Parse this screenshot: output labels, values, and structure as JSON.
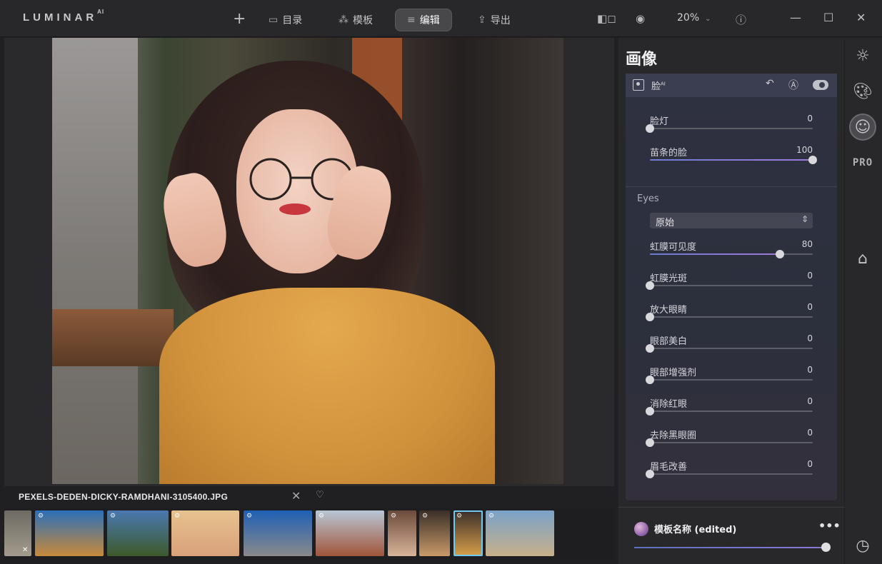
{
  "app": {
    "logo_text": "LUMINAR",
    "logo_sup": "AI"
  },
  "nav": {
    "add_label": "+",
    "catalog_label": "目录",
    "templates_label": "模板",
    "edit_label": "编辑",
    "export_label": "导出"
  },
  "toolbar": {
    "zoom_value": "20%"
  },
  "canvas": {
    "filename": "PEXELS-DEDEN-DICKY-RAMDHANI-3105400.JPG"
  },
  "filmstrip": {
    "thumbnails": [
      {
        "name": "thumb-partial",
        "selected": false,
        "colors": [
          "#6d6a62",
          "#a39c8e"
        ]
      },
      {
        "name": "thumb-mountain",
        "selected": false,
        "colors": [
          "#2b6fb8",
          "#c88a3a"
        ]
      },
      {
        "name": "thumb-landscape-clouds",
        "selected": false,
        "colors": [
          "#4a78b0",
          "#3e5a2a"
        ]
      },
      {
        "name": "thumb-girl-smile",
        "selected": false,
        "colors": [
          "#e6c38e",
          "#d9a07a"
        ]
      },
      {
        "name": "thumb-road-moon",
        "selected": false,
        "colors": [
          "#1f5fb4",
          "#8a8a8a"
        ]
      },
      {
        "name": "thumb-woman-curly",
        "selected": false,
        "colors": [
          "#b9c6d6",
          "#a0553a"
        ]
      },
      {
        "name": "thumb-portrait-warm",
        "selected": false,
        "colors": [
          "#6a4a3a",
          "#d8b49a"
        ]
      },
      {
        "name": "thumb-portrait-flower",
        "selected": false,
        "colors": [
          "#3a2e28",
          "#c89a6a"
        ]
      },
      {
        "name": "thumb-current",
        "selected": true,
        "colors": [
          "#3a2e2a",
          "#d8a04a"
        ]
      },
      {
        "name": "thumb-lake-mountains",
        "selected": false,
        "colors": [
          "#7aa2c8",
          "#c8b08a"
        ]
      }
    ]
  },
  "panel": {
    "title": "画像",
    "section_label": "脸",
    "section_sup": "AI",
    "face_sliders": [
      {
        "label": "脸灯",
        "value": 0,
        "fraction": 0
      },
      {
        "label": "苗条的脸",
        "value": 100,
        "fraction": 1
      }
    ],
    "eyes_label": "Eyes",
    "eye_mode": "原始",
    "eye_sliders": [
      {
        "label": "虹膜可见度",
        "value": 80,
        "fraction": 0.8
      },
      {
        "label": "虹膜光斑",
        "value": 0,
        "fraction": 0
      },
      {
        "label": "放大眼睛",
        "value": 0,
        "fraction": 0
      },
      {
        "label": "眼部美白",
        "value": 0,
        "fraction": 0
      },
      {
        "label": "眼部增强剂",
        "value": 0,
        "fraction": 0
      },
      {
        "label": "消除红眼",
        "value": 0,
        "fraction": 0
      },
      {
        "label": "去除黑眼圈",
        "value": 0,
        "fraction": 0
      },
      {
        "label": "眉毛改善",
        "value": 0,
        "fraction": 0
      }
    ]
  },
  "preset": {
    "name": "模板名称 (edited)",
    "menu_label": "•••",
    "amount_fraction": 1
  },
  "tools": {
    "pro_label": "PRO"
  }
}
